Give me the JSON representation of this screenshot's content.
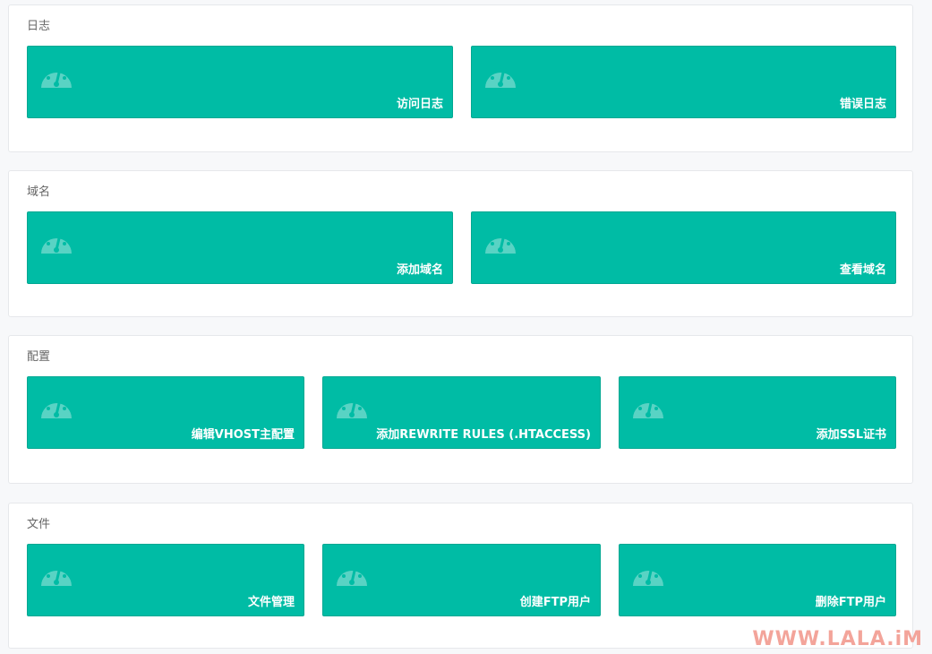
{
  "sections": [
    {
      "title": "日志",
      "items": [
        "访问日志",
        "错误日志"
      ]
    },
    {
      "title": "域名",
      "items": [
        "添加域名",
        "查看域名"
      ]
    },
    {
      "title": "配置",
      "items": [
        "编辑VHOST主配置",
        "添加REWRITE RULES (.HTACCESS)",
        "添加SSL证书"
      ]
    },
    {
      "title": "文件",
      "items": [
        "文件管理",
        "创建FTP用户",
        "删除FTP用户"
      ]
    }
  ],
  "icon": "dashboard-gauge-icon",
  "colors": {
    "tile": "#00bca5",
    "panel": "#ffffff",
    "background": "#f7f8fa",
    "watermark": "#f3a49a"
  },
  "watermark": "WWW.LALA.iM"
}
